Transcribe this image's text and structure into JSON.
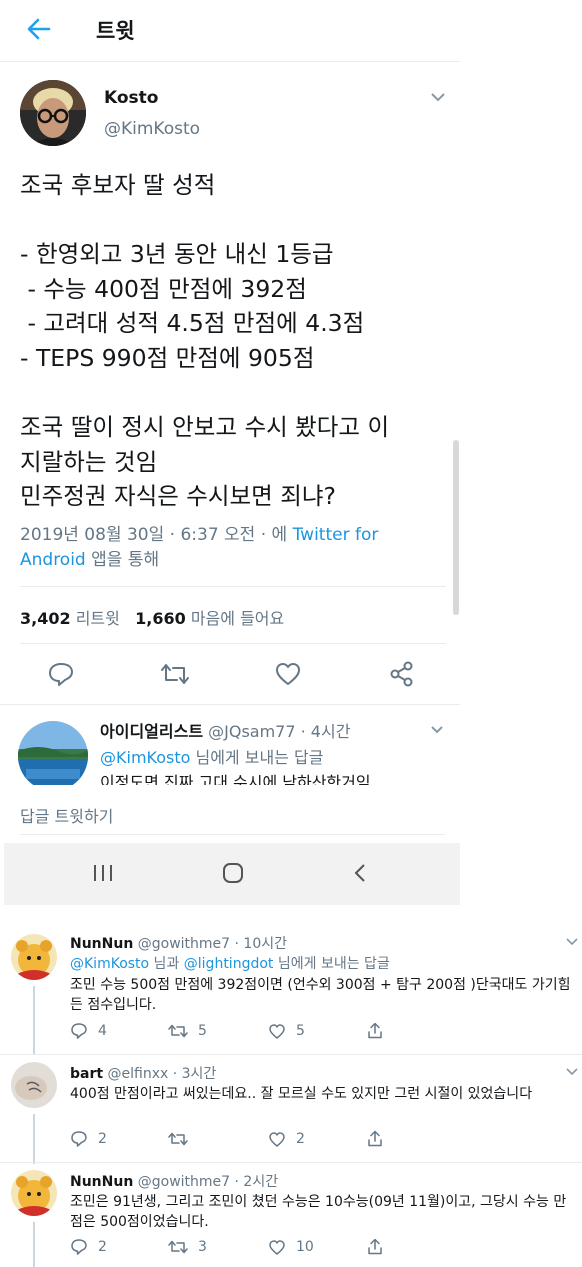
{
  "header": {
    "title": "트윗",
    "back_icon": "arrow-left-icon"
  },
  "tweet": {
    "author_name": "Kosto",
    "author_handle": "@KimKosto",
    "lines": [
      "조국 후보자 딸 성적",
      "",
      "- 한영외고 3년 동안 내신 1등급",
      " - 수능 400점 만점에 392점",
      " - 고려대 성적 4.5점 만점에 4.3점",
      "- TEPS 990점 만점에 905점",
      "",
      "조국 딸이 정시 안보고 수시 봤다고 이",
      "지랄하는 것임",
      "민주정권 자식은 수시보면 죄냐?"
    ],
    "meta_date": "2019년 08월 30일 · 6:37 오전 · 에 ",
    "meta_source_1": "Twitter for",
    "meta_source_2": "Android",
    "meta_suffix": " 앱을 통해",
    "retweet_count": "3,402",
    "retweet_label": " 리트윗",
    "like_count": "1,660",
    "like_label": " 마음에 들어요"
  },
  "reply_preview": {
    "name": "아이디얼리스트",
    "handle_time": " @JQsam77 · 4시간",
    "to_handle": "@KimKosto",
    "to_suffix": " 님에게 보내는 답글",
    "text": "이정도면 진짜 고대 수시에 낙하산한거임"
  },
  "compose": {
    "placeholder": "답글 트윗하기"
  },
  "comments": [
    {
      "name": "NunNun",
      "handle_time": " @gowithme7 · 10시간",
      "reply_to_1": "@KimKosto",
      "reply_mid": " 님과 ",
      "reply_to_2": "@lightingdot",
      "reply_suffix": " 님에게 보내는 답글",
      "text": "조민 수능 500점 만점에 392점이면 (언수외 300점 + 탐구 200점 )단국대도 가기힘든 점수입니다.",
      "replies": "4",
      "retweets": "5",
      "likes": "5"
    },
    {
      "name": "bart",
      "handle_time": " @elfinxx · 3시간",
      "text": "400점 만점이라고 써있는데요.. 잘 모르실 수도 있지만 그런 시절이 있었습니다",
      "replies": "2",
      "retweets": "",
      "likes": "2"
    },
    {
      "name": "NunNun",
      "handle_time": " @gowithme7 · 2시간",
      "text": "조민은 91년생, 그리고 조민이 쳤던 수능은 10수능(09년 11월)이고, 그당시 수능 만점은 500점이었습니다.",
      "replies": "2",
      "retweets": "3",
      "likes": "10"
    }
  ],
  "colors": {
    "link": "#1b95e0",
    "secondary_text": "#657786",
    "divider": "#e6ecf0"
  }
}
